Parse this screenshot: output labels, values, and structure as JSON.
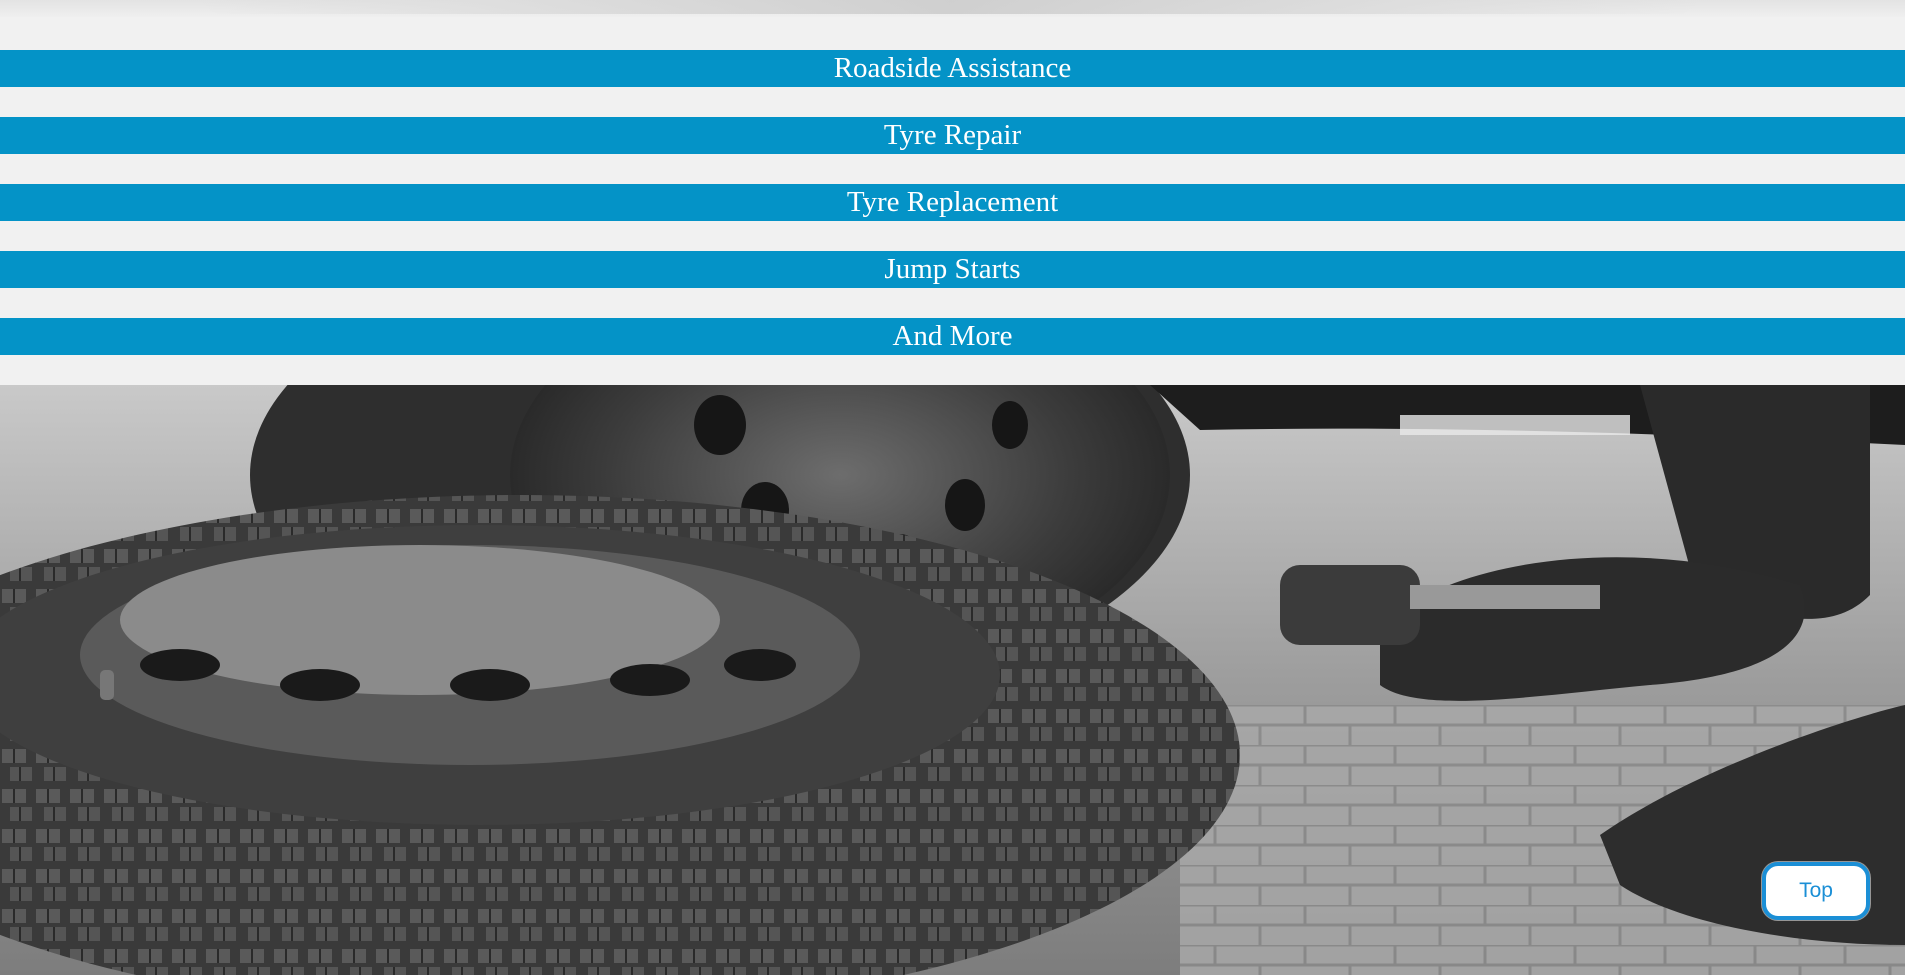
{
  "services": [
    {
      "label": "Roadside Assistance"
    },
    {
      "label": "Tyre Repair"
    },
    {
      "label": "Tyre Replacement"
    },
    {
      "label": "Jump Starts"
    },
    {
      "label": "And More"
    }
  ],
  "back_to_top": {
    "label": "Top"
  },
  "colors": {
    "accent": "#0493c7",
    "background": "#f1f1f1",
    "top_button_border": "#1b8fd6"
  }
}
